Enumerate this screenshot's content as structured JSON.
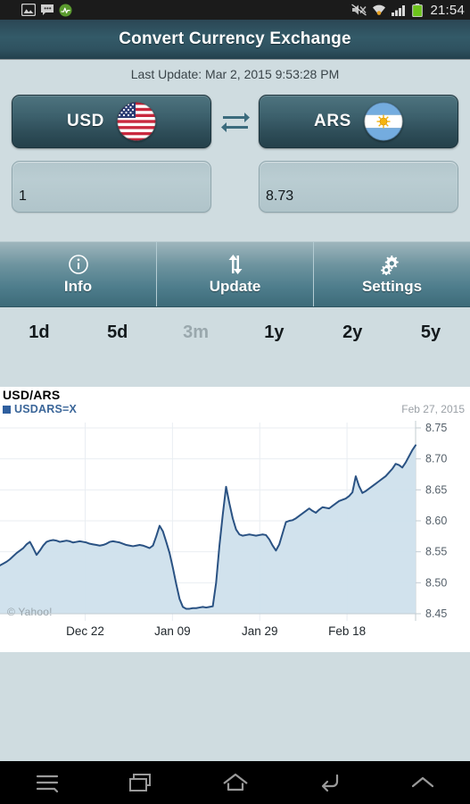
{
  "statusbar": {
    "icons": [
      "gallery-icon",
      "bbm-chat-icon",
      "green-app-icon"
    ],
    "right_icons": [
      "mute-icon",
      "wifi-icon",
      "signal-icon",
      "battery-icon"
    ],
    "clock": "21:54"
  },
  "header": {
    "title": "Convert Currency Exchange",
    "last_update": "Last Update: Mar 2, 2015 9:53:28 PM"
  },
  "converter": {
    "from": {
      "code": "USD",
      "flag": "us-flag-icon",
      "amount": "1"
    },
    "to": {
      "code": "ARS",
      "flag": "ar-flag-icon",
      "amount": "8.73"
    },
    "swap_icon": "swap-arrows-icon",
    "refresh_icon": "refresh-icon"
  },
  "actions": [
    {
      "label": "Info",
      "icon": "info-circle-icon"
    },
    {
      "label": "Update",
      "icon": "up-down-arrows-icon"
    },
    {
      "label": "Settings",
      "icon": "gears-icon"
    }
  ],
  "ranges": [
    {
      "label": "1d",
      "disabled": false
    },
    {
      "label": "5d",
      "disabled": false
    },
    {
      "label": "3m",
      "disabled": true
    },
    {
      "label": "1y",
      "disabled": false
    },
    {
      "label": "2y",
      "disabled": false
    },
    {
      "label": "5y",
      "disabled": false
    }
  ],
  "navbar": {
    "items": [
      "menu-icon",
      "recents-icon",
      "home-icon",
      "back-icon",
      "chevron-up-icon"
    ]
  },
  "chart_data": {
    "type": "area",
    "title": "USD/ARS",
    "legend": "USDARS=X",
    "legend_position": "top-left",
    "legend_color": "#2f5f9e",
    "annotation_date": "Feb 27, 2015",
    "watermark": "© Yahoo!",
    "xlabel": "",
    "ylabel": "",
    "grid": true,
    "ylim": [
      8.45,
      8.75
    ],
    "yticks": [
      "8.45",
      "8.50",
      "8.55",
      "8.60",
      "8.65",
      "8.70",
      "8.75"
    ],
    "ytick_values": [
      8.45,
      8.5,
      8.55,
      8.6,
      8.65,
      8.7,
      8.75
    ],
    "xticks": [
      "Dec 22",
      "Jan 09",
      "Jan 29",
      "Feb 18"
    ],
    "xtick_positions": [
      0.205,
      0.415,
      0.625,
      0.835
    ],
    "line_color": "#2a5283",
    "fill_color": "#cfe0ec",
    "series": [
      {
        "name": "USDARS=X",
        "x": [
          0.0,
          0.008,
          0.016,
          0.024,
          0.032,
          0.04,
          0.048,
          0.056,
          0.064,
          0.072,
          0.08,
          0.088,
          0.096,
          0.104,
          0.112,
          0.12,
          0.128,
          0.136,
          0.144,
          0.152,
          0.16,
          0.168,
          0.176,
          0.184,
          0.192,
          0.2,
          0.208,
          0.216,
          0.224,
          0.232,
          0.24,
          0.248,
          0.256,
          0.264,
          0.272,
          0.28,
          0.288,
          0.296,
          0.304,
          0.312,
          0.32,
          0.328,
          0.336,
          0.344,
          0.352,
          0.36,
          0.368,
          0.376,
          0.384,
          0.392,
          0.4,
          0.408,
          0.416,
          0.424,
          0.432,
          0.44,
          0.448,
          0.456,
          0.464,
          0.472,
          0.48,
          0.488,
          0.496,
          0.504,
          0.512,
          0.52,
          0.528,
          0.536,
          0.544,
          0.552,
          0.56,
          0.568,
          0.576,
          0.584,
          0.592,
          0.6,
          0.608,
          0.616,
          0.624,
          0.632,
          0.64,
          0.648,
          0.656,
          0.664,
          0.672,
          0.68,
          0.688,
          0.696,
          0.704,
          0.712,
          0.72,
          0.728,
          0.736,
          0.744,
          0.752,
          0.76,
          0.768,
          0.776,
          0.784,
          0.792,
          0.8,
          0.808,
          0.816,
          0.824,
          0.832,
          0.84,
          0.848,
          0.856,
          0.864,
          0.872,
          0.88,
          0.888,
          0.896,
          0.904,
          0.912,
          0.92,
          0.928,
          0.936,
          0.944,
          0.952,
          0.96,
          0.968,
          0.976,
          0.984,
          0.992,
          1.0
        ],
        "values": [
          8.528,
          8.531,
          8.534,
          8.538,
          8.543,
          8.548,
          8.552,
          8.556,
          8.562,
          8.566,
          8.556,
          8.545,
          8.552,
          8.56,
          8.566,
          8.568,
          8.569,
          8.568,
          8.566,
          8.567,
          8.568,
          8.567,
          8.565,
          8.566,
          8.567,
          8.566,
          8.565,
          8.563,
          8.562,
          8.561,
          8.56,
          8.561,
          8.563,
          8.566,
          8.567,
          8.566,
          8.565,
          8.563,
          8.561,
          8.56,
          8.559,
          8.56,
          8.561,
          8.56,
          8.558,
          8.556,
          8.56,
          8.575,
          8.592,
          8.583,
          8.566,
          8.548,
          8.524,
          8.498,
          8.474,
          8.461,
          8.458,
          8.458,
          8.459,
          8.459,
          8.46,
          8.461,
          8.46,
          8.461,
          8.462,
          8.5,
          8.56,
          8.61,
          8.655,
          8.628,
          8.604,
          8.586,
          8.578,
          8.576,
          8.577,
          8.578,
          8.577,
          8.576,
          8.577,
          8.578,
          8.577,
          8.57,
          8.56,
          8.552,
          8.562,
          8.58,
          8.598,
          8.6,
          8.601,
          8.604,
          8.608,
          8.612,
          8.616,
          8.62,
          8.616,
          8.613,
          8.618,
          8.622,
          8.621,
          8.62,
          8.624,
          8.628,
          8.632,
          8.634,
          8.636,
          8.64,
          8.646,
          8.672,
          8.656,
          8.645,
          8.648,
          8.652,
          8.656,
          8.66,
          8.664,
          8.668,
          8.672,
          8.678,
          8.684,
          8.692,
          8.69,
          8.686,
          8.694,
          8.704,
          8.714,
          8.722
        ]
      }
    ]
  }
}
